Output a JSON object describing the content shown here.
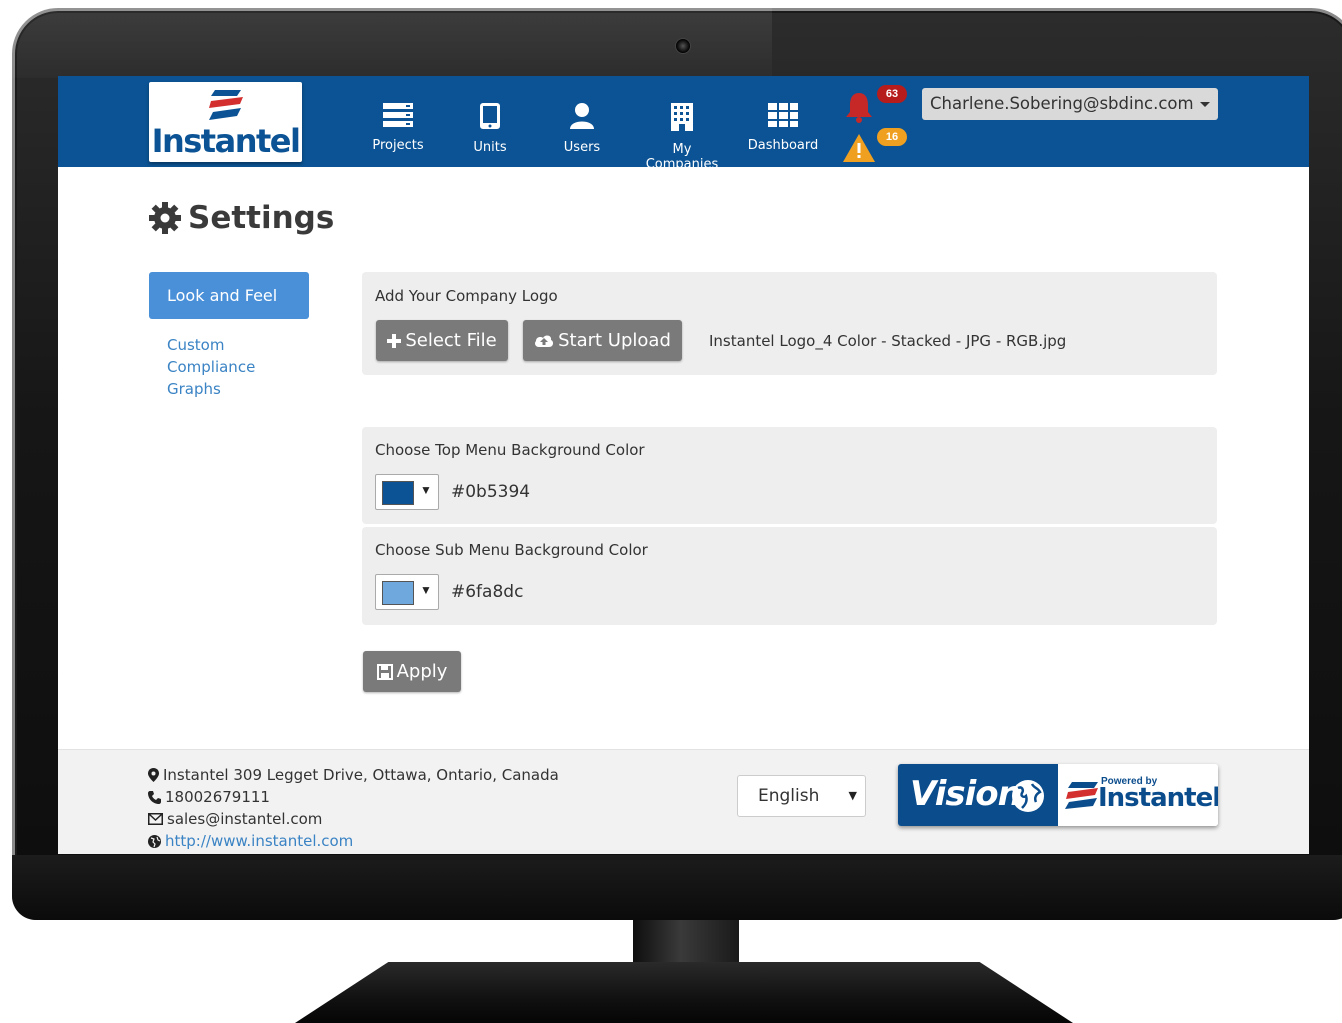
{
  "brand": {
    "logo_text": "Instantel",
    "accent": "#0b5394"
  },
  "nav": {
    "items": [
      {
        "label": "Projects",
        "icon": "server-icon"
      },
      {
        "label": "Units",
        "icon": "tablet-icon"
      },
      {
        "label": "Users",
        "icon": "user-icon"
      },
      {
        "label": "My Companies",
        "icon": "building-icon"
      },
      {
        "label": "Dashboard",
        "icon": "grid-icon"
      }
    ],
    "alarm_count": "63",
    "warning_count": "16",
    "user_email": "Charlene.Sobering@sbdinc.com"
  },
  "page": {
    "title": "Settings"
  },
  "sidebar": {
    "active_label": "Look and Feel",
    "links": [
      "Custom",
      "Compliance",
      "Graphs"
    ]
  },
  "logo_panel": {
    "label": "Add Your Company Logo",
    "select_button": "Select File",
    "upload_button": "Start Upload",
    "file_name": "Instantel Logo_4 Color - Stacked - JPG - RGB.jpg"
  },
  "top_menu_color": {
    "label": "Choose Top Menu Background Color",
    "value": "#0b5394"
  },
  "sub_menu_color": {
    "label": "Choose Sub Menu Background Color",
    "value": "#6fa8dc"
  },
  "apply_button": "Apply",
  "footer": {
    "address": "Instantel 309 Legget Drive, Ottawa, Ontario, Canada",
    "phone": "18002679111",
    "email": "sales@instantel.com",
    "website": "http://www.instantel.com",
    "language": "English",
    "vision_text": "Vision",
    "powered_by": "Powered by",
    "powered_brand": "Instantel"
  }
}
